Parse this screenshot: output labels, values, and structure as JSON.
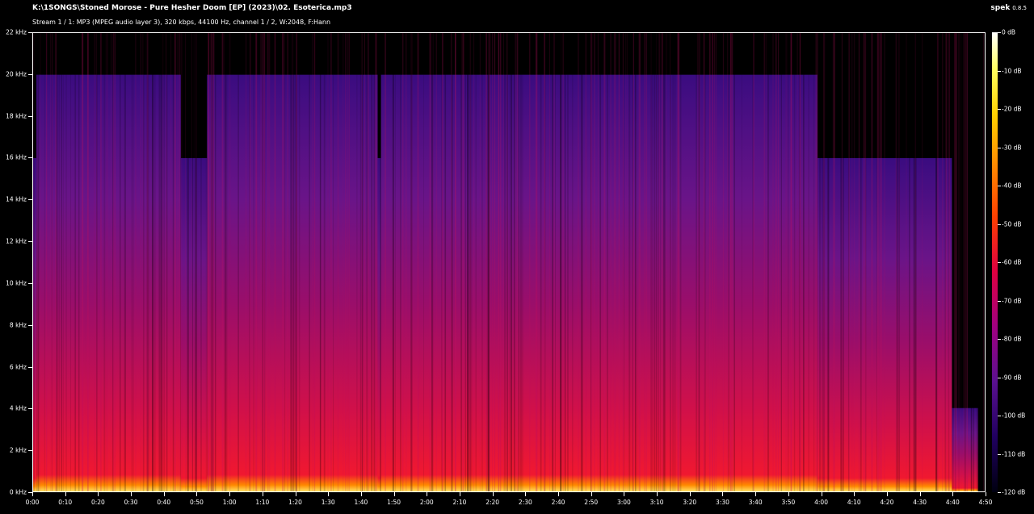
{
  "window": {
    "title": "K:\\1SONGS\\Stoned Morose - Pure Hesher Doom [EP] (2023)\\02. Esoterica.mp3",
    "stream_info": "Stream 1 / 1: MP3 (MPEG audio layer 3), 320 kbps, 44100 Hz, channel 1 / 2, W:2048, F:Hann",
    "app_name": "spek",
    "app_version": "0.8.5"
  },
  "colors": {
    "background": "#000000",
    "text": "#ffffff"
  },
  "chart_data": {
    "type": "heatmap",
    "y_ticks": [
      "22 kHz",
      "20 kHz",
      "18 kHz",
      "16 kHz",
      "14 kHz",
      "12 kHz",
      "10 kHz",
      "8 kHz",
      "6 kHz",
      "4 kHz",
      "2 kHz",
      "0 kHz"
    ],
    "x_ticks": [
      "0:00",
      "0:10",
      "0:20",
      "0:30",
      "0:40",
      "0:50",
      "1:00",
      "1:10",
      "1:20",
      "1:30",
      "1:40",
      "1:50",
      "2:00",
      "2:10",
      "2:20",
      "2:30",
      "2:40",
      "2:50",
      "3:00",
      "3:10",
      "3:20",
      "3:30",
      "3:40",
      "3:50",
      "4:00",
      "4:10",
      "4:20",
      "4:30",
      "4:40",
      "4:50"
    ],
    "colorbar_ticks": [
      "0 dB",
      "-10 dB",
      "-20 dB",
      "-30 dB",
      "-40 dB",
      "-50 dB",
      "-60 dB",
      "-70 dB",
      "-80 dB",
      "-90 dB",
      "-100 dB",
      "-110 dB",
      "-120 dB"
    ],
    "ylim": [
      0,
      22
    ],
    "xlim_seconds": [
      0,
      290
    ],
    "cutoff_segments": [
      {
        "start": 0,
        "end": 1,
        "top_khz": 16
      },
      {
        "start": 1,
        "end": 13,
        "top_khz": 20
      },
      {
        "start": 13,
        "end": 16,
        "top_khz": 20
      },
      {
        "start": 16,
        "end": 45,
        "top_khz": 20
      },
      {
        "start": 45,
        "end": 53,
        "top_khz": 16
      },
      {
        "start": 53,
        "end": 105,
        "top_khz": 20
      },
      {
        "start": 105,
        "end": 106,
        "top_khz": 16
      },
      {
        "start": 106,
        "end": 119,
        "top_khz": 20
      },
      {
        "start": 119,
        "end": 180,
        "top_khz": 20
      },
      {
        "start": 180,
        "end": 239,
        "top_khz": 20
      },
      {
        "start": 239,
        "end": 280,
        "top_khz": 16
      },
      {
        "start": 280,
        "end": 288,
        "top_khz": 4
      },
      {
        "start": 288,
        "end": 290,
        "top_khz": 0
      }
    ]
  }
}
